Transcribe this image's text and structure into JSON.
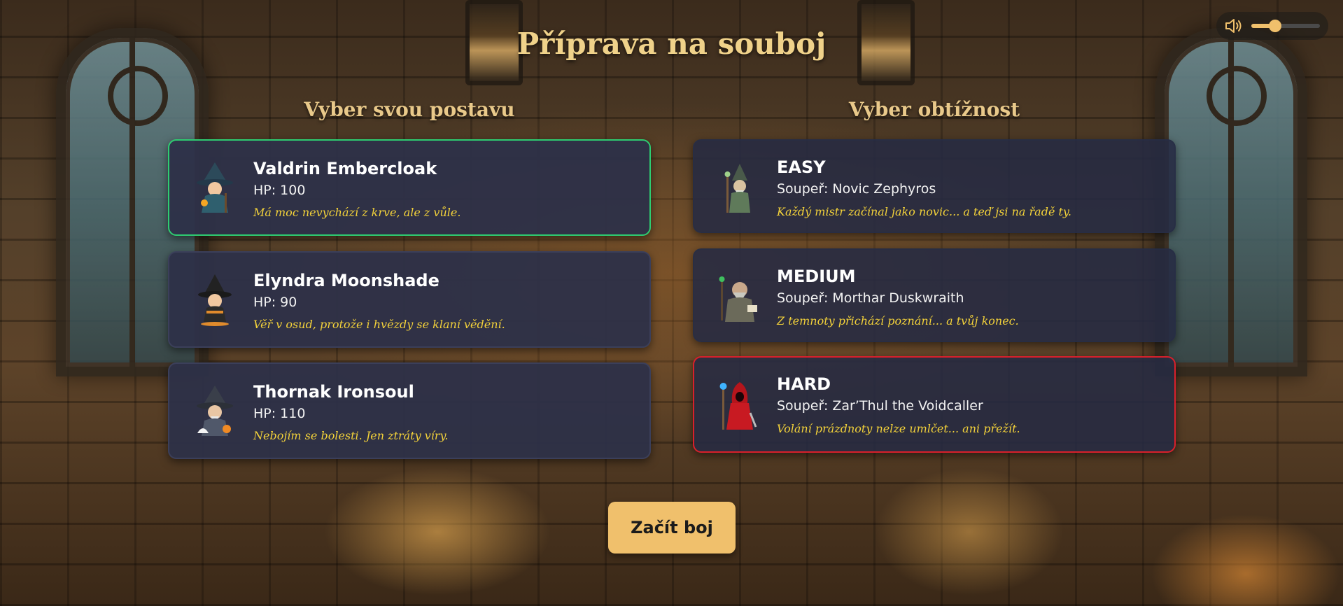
{
  "page": {
    "title": "Příprava na souboj"
  },
  "volume": {
    "icon": "speaker-icon",
    "level": 0.35
  },
  "characters": {
    "heading": "Vyber svou postavu",
    "items": [
      {
        "name": "Valdrin Embercloak",
        "hp": "HP: 100",
        "quote": "Má moc nevychází z krve, ale z vůle.",
        "portrait": "wizard-teal-icon",
        "selected": true
      },
      {
        "name": "Elyndra Moonshade",
        "hp": "HP: 90",
        "quote": "Věř v osud, protože i hvězdy se klaní vědění.",
        "portrait": "witch-orange-icon",
        "selected": false
      },
      {
        "name": "Thornak Ironsoul",
        "hp": "HP: 110",
        "quote": "Nebojím se bolesti. Jen ztráty víry.",
        "portrait": "wizard-grey-icon",
        "selected": false
      }
    ]
  },
  "difficulty": {
    "heading": "Vyber obtížnost",
    "items": [
      {
        "level": "EASY",
        "opponent": "Soupeř: Novic Zephyros",
        "quote": "Každý mistr začínal jako novic... a teď jsi na řadě ty.",
        "portrait": "green-sage-icon",
        "selected": false
      },
      {
        "level": "MEDIUM",
        "opponent": "Soupeř: Morthar Duskwraith",
        "quote": "Z temnoty přichází poznání... a tvůj konec.",
        "portrait": "old-dwarf-mage-icon",
        "selected": false
      },
      {
        "level": "HARD",
        "opponent": "Soupeř: Zar’Thul the Voidcaller",
        "quote": "Volání prázdnoty nelze umlčet... ani přežít.",
        "portrait": "red-robed-caster-icon",
        "selected": true
      }
    ]
  },
  "actions": {
    "start_label": "Začít boj"
  },
  "colors": {
    "title": "#f0d28a",
    "card": "#2d3048",
    "selected_character_border": "#2ecc71",
    "selected_difficulty_border": "#d9202b",
    "quote": "#f3d23a",
    "start_button": "#f0c06c"
  }
}
